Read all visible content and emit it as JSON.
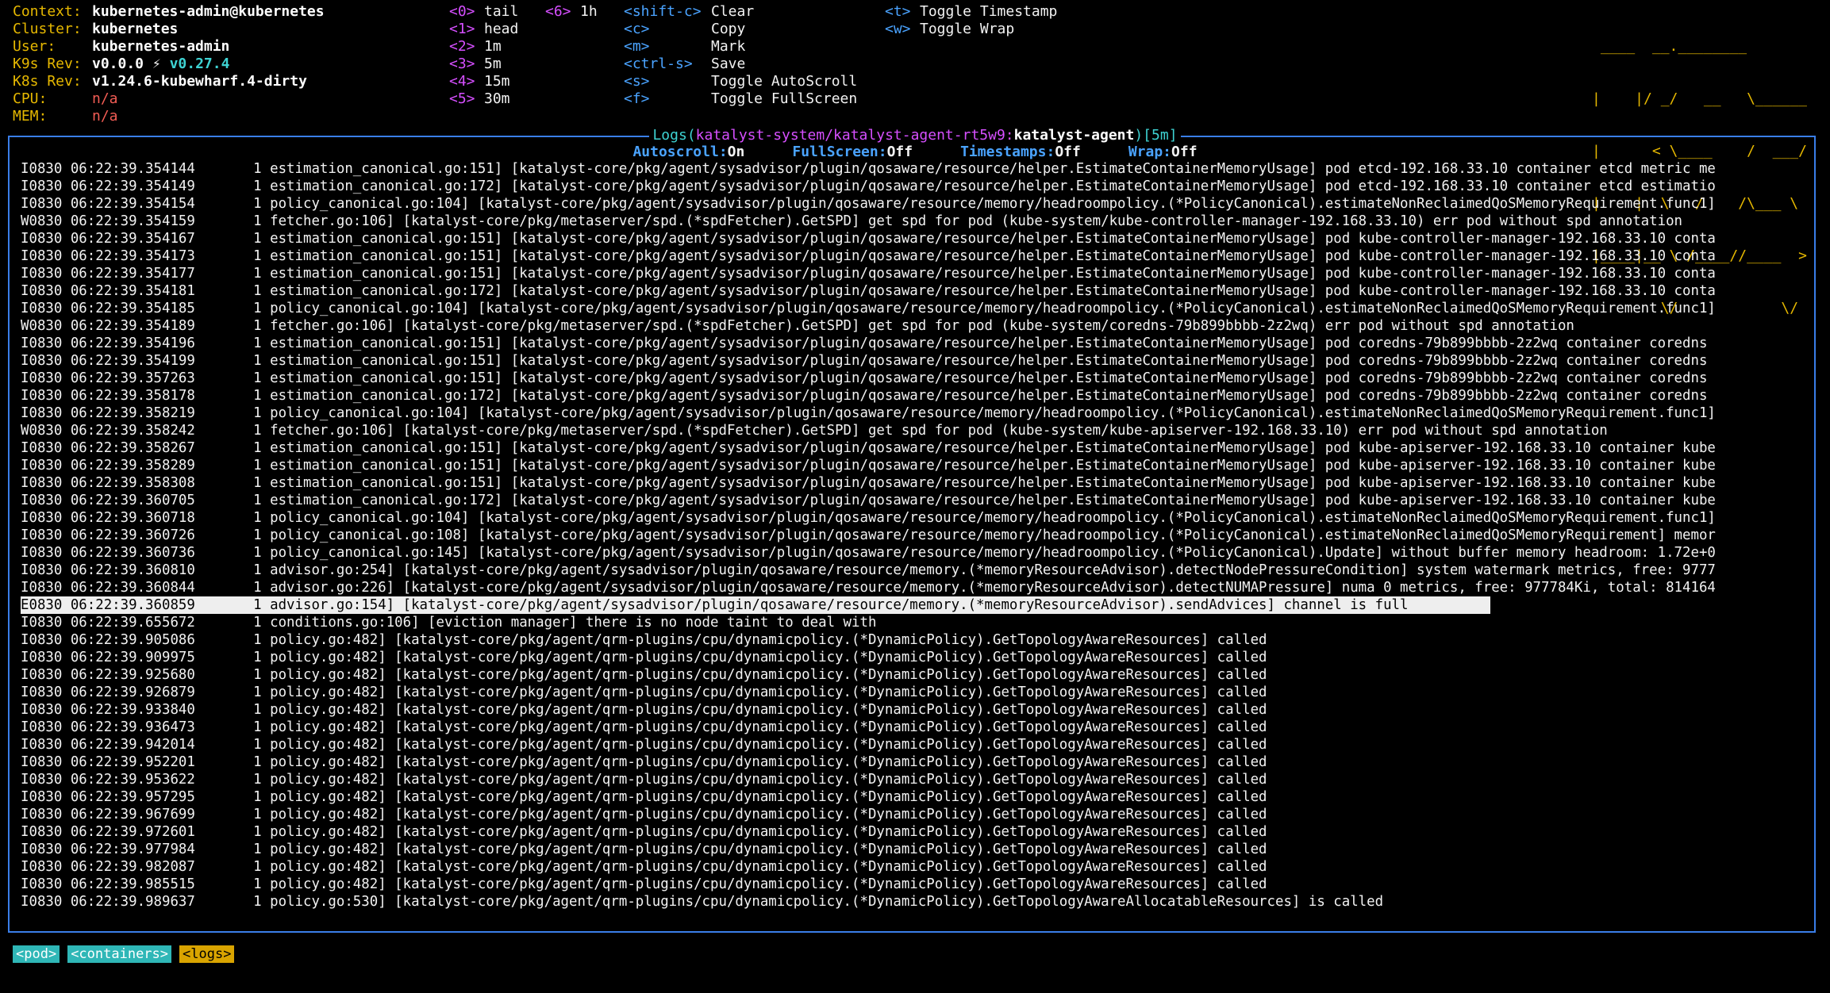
{
  "colors": {
    "background": "#000000",
    "border": "#3a7ee8",
    "info_key": "#e6b800",
    "hint_key": "#d64fff",
    "accent": "#3ed3d3",
    "error_value": "#f25c54"
  },
  "info": {
    "context_key": "Context:",
    "context_val": "kubernetes-admin@kubernetes",
    "cluster_key": "Cluster:",
    "cluster_val": "kubernetes",
    "user_key": "User:",
    "user_val": "kubernetes-admin",
    "k9s_rev_key": "K9s Rev:",
    "k9s_rev_val": "v0.0.0",
    "k9s_rev_icon": "⚡",
    "k9s_rev_latest": "v0.27.4",
    "k8s_rev_key": "K8s Rev:",
    "k8s_rev_val": "v1.24.6-kubewharf.4-dirty",
    "cpu_key": "CPU:",
    "cpu_val": "n/a",
    "mem_key": "MEM:",
    "mem_val": "n/a"
  },
  "hints_col1": [
    {
      "key": "<0>",
      "label": "tail"
    },
    {
      "key": "<1>",
      "label": "head"
    },
    {
      "key": "<2>",
      "label": "1m"
    },
    {
      "key": "<3>",
      "label": "5m"
    },
    {
      "key": "<4>",
      "label": "15m"
    },
    {
      "key": "<5>",
      "label": "30m"
    }
  ],
  "hints_col2": [
    {
      "key": "<6>",
      "label": "1h"
    }
  ],
  "hints_col3": [
    {
      "key": "<shift-c>",
      "label": "Clear"
    },
    {
      "key": "<c>",
      "label": "Copy"
    },
    {
      "key": "<m>",
      "label": "Mark"
    },
    {
      "key": "<ctrl-s>",
      "label": "Save"
    },
    {
      "key": "<s>",
      "label": "Toggle AutoScroll"
    },
    {
      "key": "<f>",
      "label": "Toggle FullScreen"
    }
  ],
  "hints_col4": [
    {
      "key": "<t>",
      "label": "Toggle Timestamp"
    },
    {
      "key": "<w>",
      "label": "Toggle Wrap"
    }
  ],
  "logo_lines": [
    " ____  __.________       ",
    "|    |/ _/   __   \\______",
    "|      < \\____    /  ___/",
    "|    |  \\   /    /\\___ \\ ",
    "|____|__ \\ /____//____  >",
    "        \\/            \\/ "
  ],
  "frame": {
    "title_prefix": "Logs(",
    "title_path": "katalyst-system/katalyst-agent-rt5w9:",
    "title_container": "katalyst-agent",
    "title_suffix": ")[5m]",
    "autoscroll_key": "Autoscroll:",
    "autoscroll_val": "On",
    "fullscreen_key": "FullScreen:",
    "fullscreen_val": "Off",
    "timestamps_key": "Timestamps:",
    "timestamps_val": "Off",
    "wrap_key": "Wrap:",
    "wrap_val": "Off"
  },
  "logs": [
    "I0830 06:22:39.354144       1 estimation_canonical.go:151] [katalyst-core/pkg/agent/sysadvisor/plugin/qosaware/resource/helper.EstimateContainerMemoryUsage] pod etcd-192.168.33.10 container etcd metric me",
    "I0830 06:22:39.354149       1 estimation_canonical.go:172] [katalyst-core/pkg/agent/sysadvisor/plugin/qosaware/resource/helper.EstimateContainerMemoryUsage] pod etcd-192.168.33.10 container etcd estimatio",
    "I0830 06:22:39.354154       1 policy_canonical.go:104] [katalyst-core/pkg/agent/sysadvisor/plugin/qosaware/resource/memory/headroompolicy.(*PolicyCanonical).estimateNonReclaimedQoSMemoryRequirement.func1]",
    "W0830 06:22:39.354159       1 fetcher.go:106] [katalyst-core/pkg/metaserver/spd.(*spdFetcher).GetSPD] get spd for pod (kube-system/kube-controller-manager-192.168.33.10) err pod without spd annotation",
    "I0830 06:22:39.354167       1 estimation_canonical.go:151] [katalyst-core/pkg/agent/sysadvisor/plugin/qosaware/resource/helper.EstimateContainerMemoryUsage] pod kube-controller-manager-192.168.33.10 conta",
    "I0830 06:22:39.354173       1 estimation_canonical.go:151] [katalyst-core/pkg/agent/sysadvisor/plugin/qosaware/resource/helper.EstimateContainerMemoryUsage] pod kube-controller-manager-192.168.33.10 conta",
    "I0830 06:22:39.354177       1 estimation_canonical.go:151] [katalyst-core/pkg/agent/sysadvisor/plugin/qosaware/resource/helper.EstimateContainerMemoryUsage] pod kube-controller-manager-192.168.33.10 conta",
    "I0830 06:22:39.354181       1 estimation_canonical.go:172] [katalyst-core/pkg/agent/sysadvisor/plugin/qosaware/resource/helper.EstimateContainerMemoryUsage] pod kube-controller-manager-192.168.33.10 conta",
    "I0830 06:22:39.354185       1 policy_canonical.go:104] [katalyst-core/pkg/agent/sysadvisor/plugin/qosaware/resource/memory/headroompolicy.(*PolicyCanonical).estimateNonReclaimedQoSMemoryRequirement.func1]",
    "W0830 06:22:39.354189       1 fetcher.go:106] [katalyst-core/pkg/metaserver/spd.(*spdFetcher).GetSPD] get spd for pod (kube-system/coredns-79b899bbbb-2z2wq) err pod without spd annotation",
    "I0830 06:22:39.354196       1 estimation_canonical.go:151] [katalyst-core/pkg/agent/sysadvisor/plugin/qosaware/resource/helper.EstimateContainerMemoryUsage] pod coredns-79b899bbbb-2z2wq container coredns",
    "I0830 06:22:39.354199       1 estimation_canonical.go:151] [katalyst-core/pkg/agent/sysadvisor/plugin/qosaware/resource/helper.EstimateContainerMemoryUsage] pod coredns-79b899bbbb-2z2wq container coredns",
    "I0830 06:22:39.357263       1 estimation_canonical.go:151] [katalyst-core/pkg/agent/sysadvisor/plugin/qosaware/resource/helper.EstimateContainerMemoryUsage] pod coredns-79b899bbbb-2z2wq container coredns",
    "I0830 06:22:39.358178       1 estimation_canonical.go:172] [katalyst-core/pkg/agent/sysadvisor/plugin/qosaware/resource/helper.EstimateContainerMemoryUsage] pod coredns-79b899bbbb-2z2wq container coredns",
    "I0830 06:22:39.358219       1 policy_canonical.go:104] [katalyst-core/pkg/agent/sysadvisor/plugin/qosaware/resource/memory/headroompolicy.(*PolicyCanonical).estimateNonReclaimedQoSMemoryRequirement.func1]",
    "W0830 06:22:39.358242       1 fetcher.go:106] [katalyst-core/pkg/metaserver/spd.(*spdFetcher).GetSPD] get spd for pod (kube-system/kube-apiserver-192.168.33.10) err pod without spd annotation",
    "I0830 06:22:39.358267       1 estimation_canonical.go:151] [katalyst-core/pkg/agent/sysadvisor/plugin/qosaware/resource/helper.EstimateContainerMemoryUsage] pod kube-apiserver-192.168.33.10 container kube",
    "I0830 06:22:39.358289       1 estimation_canonical.go:151] [katalyst-core/pkg/agent/sysadvisor/plugin/qosaware/resource/helper.EstimateContainerMemoryUsage] pod kube-apiserver-192.168.33.10 container kube",
    "I0830 06:22:39.358308       1 estimation_canonical.go:151] [katalyst-core/pkg/agent/sysadvisor/plugin/qosaware/resource/helper.EstimateContainerMemoryUsage] pod kube-apiserver-192.168.33.10 container kube",
    "I0830 06:22:39.360705       1 estimation_canonical.go:172] [katalyst-core/pkg/agent/sysadvisor/plugin/qosaware/resource/helper.EstimateContainerMemoryUsage] pod kube-apiserver-192.168.33.10 container kube",
    "I0830 06:22:39.360718       1 policy_canonical.go:104] [katalyst-core/pkg/agent/sysadvisor/plugin/qosaware/resource/memory/headroompolicy.(*PolicyCanonical).estimateNonReclaimedQoSMemoryRequirement.func1]",
    "I0830 06:22:39.360726       1 policy_canonical.go:108] [katalyst-core/pkg/agent/sysadvisor/plugin/qosaware/resource/memory/headroompolicy.(*PolicyCanonical).estimateNonReclaimedQoSMemoryRequirement] memor",
    "I0830 06:22:39.360736       1 policy_canonical.go:145] [katalyst-core/pkg/agent/sysadvisor/plugin/qosaware/resource/memory/headroompolicy.(*PolicyCanonical).Update] without buffer memory headroom: 1.72e+0",
    "I0830 06:22:39.360810       1 advisor.go:254] [katalyst-core/pkg/agent/sysadvisor/plugin/qosaware/resource/memory.(*memoryResourceAdvisor).detectNodePressureCondition] system watermark metrics, free: 9777",
    "I0830 06:22:39.360844       1 advisor.go:226] [katalyst-core/pkg/agent/sysadvisor/plugin/qosaware/resource/memory.(*memoryResourceAdvisor).detectNUMAPressure] numa 0 metrics, free: 977784Ki, total: 814164",
    "E0830 06:22:39.360859       1 advisor.go:154] [katalyst-core/pkg/agent/sysadvisor/plugin/qosaware/resource/memory.(*memoryResourceAdvisor).sendAdvices] channel is full",
    "I0830 06:22:39.655672       1 conditions.go:106] [eviction manager] there is no node taint to deal with",
    "I0830 06:22:39.905086       1 policy.go:482] [katalyst-core/pkg/agent/qrm-plugins/cpu/dynamicpolicy.(*DynamicPolicy).GetTopologyAwareResources] called",
    "I0830 06:22:39.909975       1 policy.go:482] [katalyst-core/pkg/agent/qrm-plugins/cpu/dynamicpolicy.(*DynamicPolicy).GetTopologyAwareResources] called",
    "I0830 06:22:39.925680       1 policy.go:482] [katalyst-core/pkg/agent/qrm-plugins/cpu/dynamicpolicy.(*DynamicPolicy).GetTopologyAwareResources] called",
    "I0830 06:22:39.926879       1 policy.go:482] [katalyst-core/pkg/agent/qrm-plugins/cpu/dynamicpolicy.(*DynamicPolicy).GetTopologyAwareResources] called",
    "I0830 06:22:39.933840       1 policy.go:482] [katalyst-core/pkg/agent/qrm-plugins/cpu/dynamicpolicy.(*DynamicPolicy).GetTopologyAwareResources] called",
    "I0830 06:22:39.936473       1 policy.go:482] [katalyst-core/pkg/agent/qrm-plugins/cpu/dynamicpolicy.(*DynamicPolicy).GetTopologyAwareResources] called",
    "I0830 06:22:39.942014       1 policy.go:482] [katalyst-core/pkg/agent/qrm-plugins/cpu/dynamicpolicy.(*DynamicPolicy).GetTopologyAwareResources] called",
    "I0830 06:22:39.952201       1 policy.go:482] [katalyst-core/pkg/agent/qrm-plugins/cpu/dynamicpolicy.(*DynamicPolicy).GetTopologyAwareResources] called",
    "I0830 06:22:39.953622       1 policy.go:482] [katalyst-core/pkg/agent/qrm-plugins/cpu/dynamicpolicy.(*DynamicPolicy).GetTopologyAwareResources] called",
    "I0830 06:22:39.957295       1 policy.go:482] [katalyst-core/pkg/agent/qrm-plugins/cpu/dynamicpolicy.(*DynamicPolicy).GetTopologyAwareResources] called",
    "I0830 06:22:39.967699       1 policy.go:482] [katalyst-core/pkg/agent/qrm-plugins/cpu/dynamicpolicy.(*DynamicPolicy).GetTopologyAwareResources] called",
    "I0830 06:22:39.972601       1 policy.go:482] [katalyst-core/pkg/agent/qrm-plugins/cpu/dynamicpolicy.(*DynamicPolicy).GetTopologyAwareResources] called",
    "I0830 06:22:39.977984       1 policy.go:482] [katalyst-core/pkg/agent/qrm-plugins/cpu/dynamicpolicy.(*DynamicPolicy).GetTopologyAwareResources] called",
    "I0830 06:22:39.982087       1 policy.go:482] [katalyst-core/pkg/agent/qrm-plugins/cpu/dynamicpolicy.(*DynamicPolicy).GetTopologyAwareResources] called",
    "I0830 06:22:39.985515       1 policy.go:482] [katalyst-core/pkg/agent/qrm-plugins/cpu/dynamicpolicy.(*DynamicPolicy).GetTopologyAwareResources] called",
    "I0830 06:22:39.989637       1 policy.go:530] [katalyst-core/pkg/agent/qrm-plugins/cpu/dynamicpolicy.(*DynamicPolicy).GetTopologyAwareAllocatableResources] is called"
  ],
  "selected_log_index": 25,
  "crumbs": [
    {
      "label": "<pod>",
      "style": "blue"
    },
    {
      "label": "<containers>",
      "style": "blue"
    },
    {
      "label": "<logs>",
      "style": "gold"
    }
  ]
}
